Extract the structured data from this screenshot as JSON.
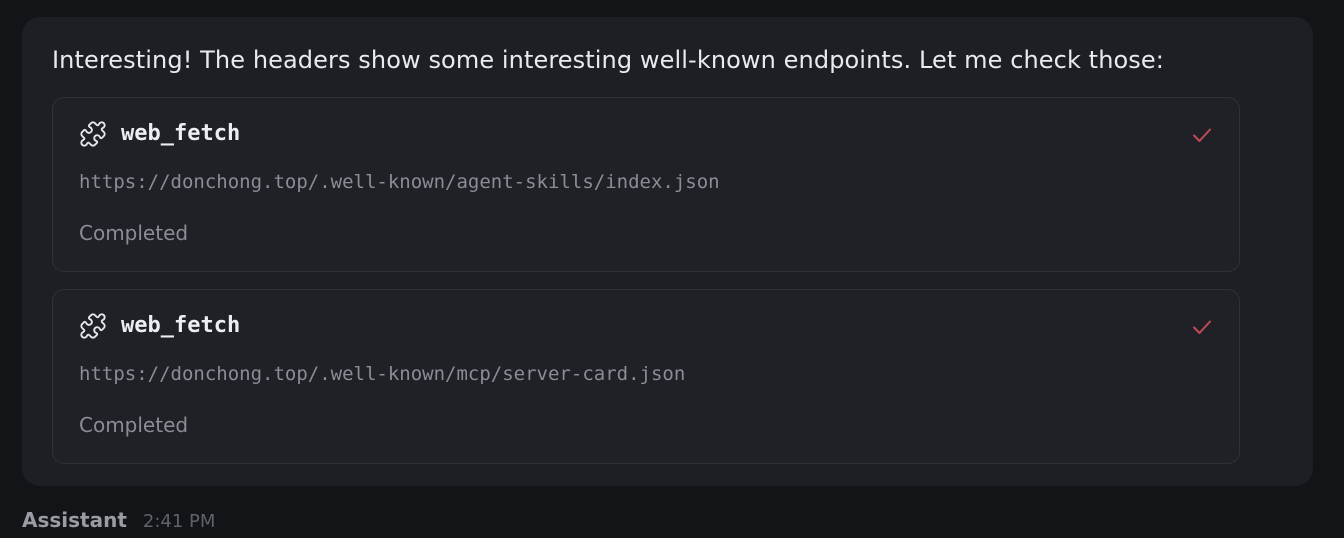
{
  "message": {
    "text": "Interesting! The headers show some interesting well-known endpoints. Let me check those:"
  },
  "tool_calls": [
    {
      "icon": "puzzle-icon",
      "name": "web_fetch",
      "url": "https://donchong.top/.well-known/agent-skills/index.json",
      "status": "Completed",
      "status_icon": "checkmark-icon"
    },
    {
      "icon": "puzzle-icon",
      "name": "web_fetch",
      "url": "https://donchong.top/.well-known/mcp/server-card.json",
      "status": "Completed",
      "status_icon": "checkmark-icon"
    }
  ],
  "meta": {
    "author": "Assistant",
    "time": "2:41 PM"
  },
  "colors": {
    "background": "#131418",
    "bubble": "#1d1f24",
    "card_border": "#2f3138",
    "check": "#c24a55",
    "muted_text": "#8a8d96"
  }
}
